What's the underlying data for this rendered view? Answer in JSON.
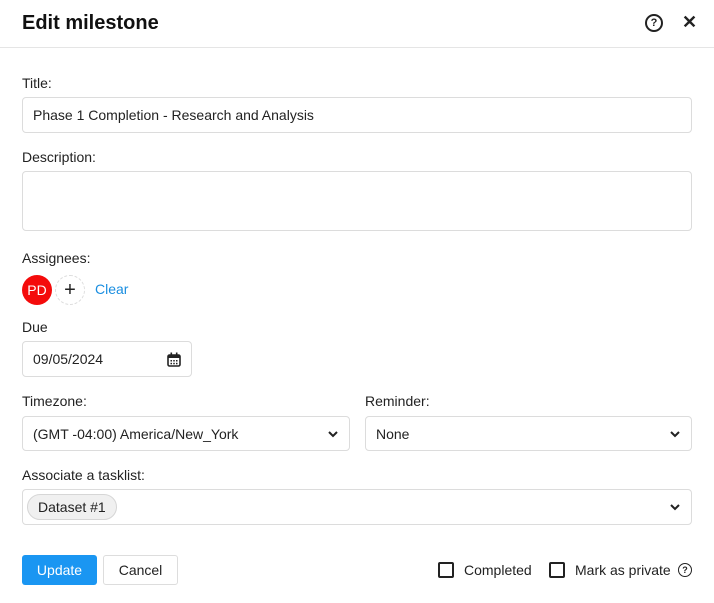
{
  "header": {
    "title": "Edit milestone",
    "help_icon": "?",
    "close_icon": "✕"
  },
  "form": {
    "title_label": "Title:",
    "title_value": "Phase 1 Completion - Research and Analysis",
    "description_label": "Description:",
    "description_value": "",
    "assignees_label": "Assignees:",
    "assignees": [
      {
        "initials": "PD",
        "color": "#f40b0b"
      }
    ],
    "add_assignee_icon": "+",
    "clear_label": "Clear",
    "due_label": "Due",
    "due_value": "09/05/2024",
    "timezone_label": "Timezone:",
    "timezone_value": "(GMT -04:00) America/New_York",
    "reminder_label": "Reminder:",
    "reminder_value": "None",
    "tasklist_label": "Associate a tasklist:",
    "tasklist_chips": [
      "Dataset #1"
    ]
  },
  "footer": {
    "update_label": "Update",
    "cancel_label": "Cancel",
    "completed_label": "Completed",
    "completed_checked": false,
    "private_label": "Mark as private",
    "private_checked": false,
    "private_help_icon": "?"
  }
}
